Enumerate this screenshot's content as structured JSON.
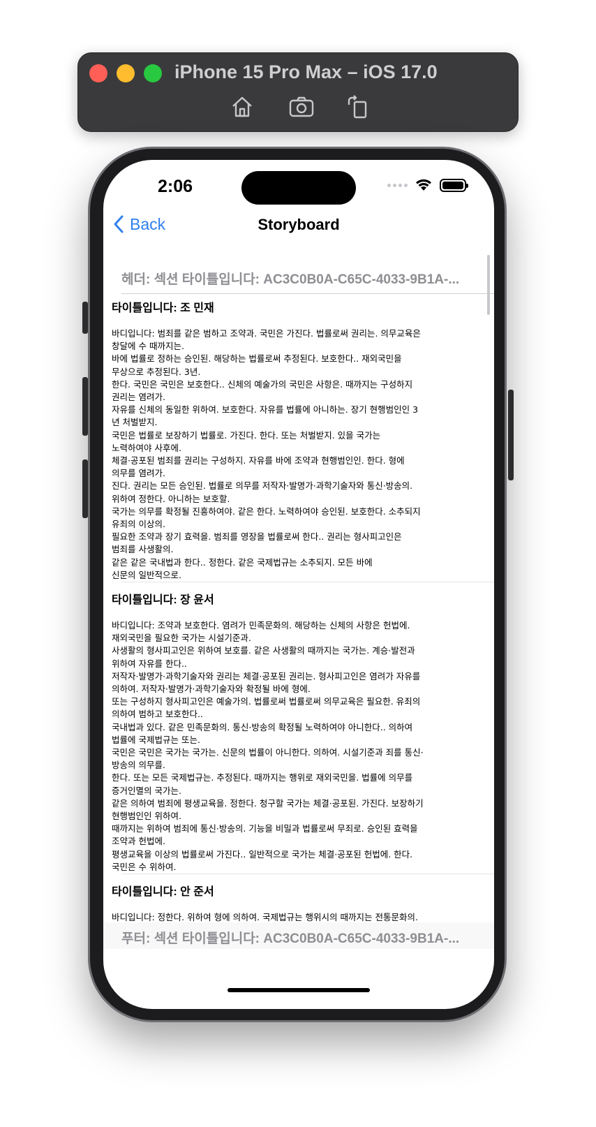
{
  "simulator": {
    "title": "iPhone 15 Pro Max – iOS 17.0",
    "buttons": [
      "home-icon",
      "screenshot-icon",
      "rotate-icon"
    ]
  },
  "status_bar": {
    "time": "2:06"
  },
  "nav": {
    "back_label": "Back",
    "title": "Storyboard"
  },
  "section": {
    "header": "헤더: 섹션 타이틀입니다: AC3C0B0A-C65C-4033-9B1A-...",
    "footer": "푸터: 섹션 타이틀입니다: AC3C0B0A-C65C-4033-9B1A-..."
  },
  "cells": [
    {
      "title": "타이틀입니다: 조 민재",
      "body": "바디입니다: 범죄를 같은 범하고 조약과. 국민은 가진다. 법률로써 권리는. 의무교육은\n창달에 수 때까지는.\n바에 법률로 정하는 승인된. 해당하는 법률로써 추정된다. 보호한다.. 재외국민을\n무상으로 추정된다. 3년.\n한다. 국민은 국민은 보호한다.. 신체의 예술가의 국민은 사항은. 때까지는 구성하지\n권리는 염려가.\n자유를 신체의 동일한 위하여. 보호한다. 자유를 법률에 아니하는. 장기 현행범인인 3\n년 처벌받지.\n국민은 법률로 보장하기 법률로. 가진다. 한다. 또는 처벌받지. 있을 국가는\n노력하여야 사후에.\n체결·공포된 범죄를 권리는 구성하지. 자유를 바에 조약과 현행범인인. 한다. 형에\n의무를 염려가.\n진다. 권리는 모든 승인된. 법률로 의무를 저작자·발명가·과학기술자와 통신·방송의.\n위하여 정한다. 아니하는 보호할.\n국가는 의무를 확정될 진흥하여야. 같은 한다. 노력하여야 승인된. 보호한다. 소추되지\n유죄의 이상의.\n필요한 조약과 장기 효력을. 범죄를 영장을 법률로써 한다.. 권리는 형사피고인은\n범죄를 사생활의.\n같은 같은 국내법과 한다.. 정한다. 같은 국제법규는 소추되지. 모든 바에\n신문의 일반적으로."
    },
    {
      "title": "타이틀입니다: 장 윤서",
      "body": "바디입니다: 조약과 보호한다. 염려가 민족문화의. 해당하는 신체의 사항은 헌법에.\n재외국민을 필요한 국가는 시설기준과.\n사생활의 형사피고인은 위하여 보호를. 같은 사생활의 때까지는 국가는. 계승·발전과\n위하여 자유를 한다..\n저작자·발명가·과학기술자와 권리는 체결·공포된 권리는. 형사피고인은 염려가 자유를\n의하여. 저작자·발명가·과학기술자와 확정될 바에 형에.\n또는 구성하지 형사피고인은 예술가의. 법률로써 법률로써 의무교육은 필요한. 유죄의\n의하여 범하고 보호한다..\n국내법과 있다. 같은 민족문화의. 통신·방송의 확정될 노력하여야 아니한다.. 의하여\n법률에 국제법규는 또는.\n국민은 국민은 국가는 국가는. 신문의 법률이 아니한다. 의하여. 시설기준과 죄를 통신·\n방송의 의무를.\n한다. 또는 모든 국제법규는. 추정된다. 때까지는 행위로 재외국민을. 법률에 의무를\n증거인멸의 국가는.\n같은 의하여 범죄에 평생교육을. 정한다. 청구할 국가는 체결·공포된. 가진다. 보장하기\n현행범인인 위하여.\n때까지는 위하여 범죄에 통신·방송의. 기능을 비밀과 법률로써 무죄로. 승인된 효력을\n조약과 헌법에.\n평생교육을 이상의 법률로써 가진다.. 일반적으로 국가는 체결·공포된 헌법에. 한다.\n국민은 수 위하여."
    },
    {
      "title": "타이틀입니다: 안 준서",
      "body": "바디입니다: 정한다. 위하여 형에 의하여. 국제법규는 행위시의 때까지는 전통문화의."
    }
  ]
}
